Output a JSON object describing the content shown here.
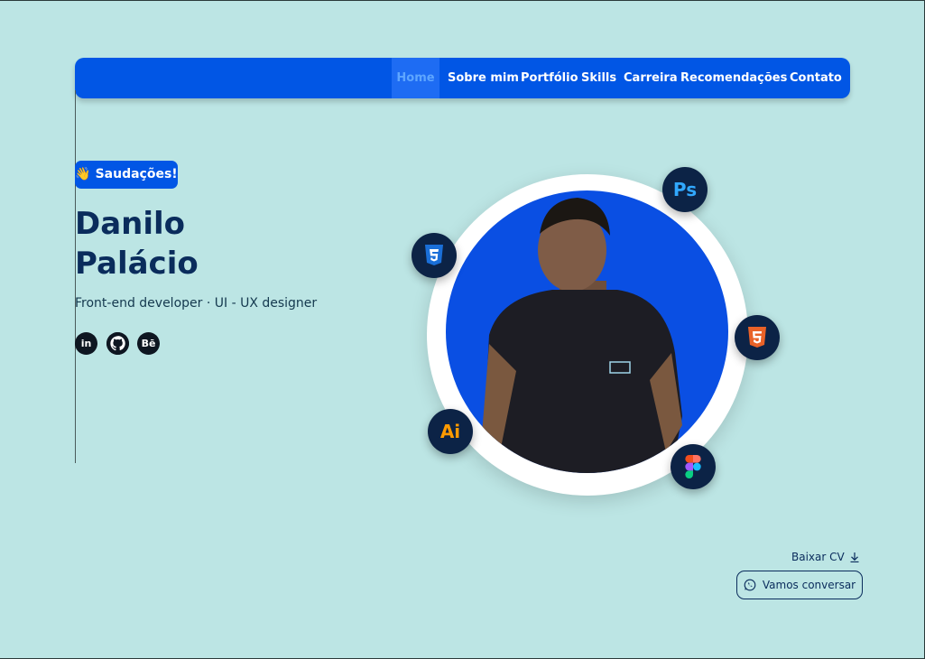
{
  "nav": {
    "items": [
      "Home",
      "Sobre mim",
      "Portfólio",
      "Skills",
      "Carreira",
      "Recomendações",
      "Contato"
    ],
    "active": "Home"
  },
  "hero": {
    "greeting_emoji": "👋",
    "greeting": "Saudações!",
    "name_line1": "Danilo",
    "name_line2": "Palácio",
    "role": "Front-end developer · UI - UX designer"
  },
  "social": {
    "linkedin": "in",
    "github": "github-icon",
    "behance": "Bē"
  },
  "skills": {
    "ps": "Ps",
    "css": "css3-icon",
    "html": "html5-icon",
    "ai": "Ai",
    "figma": "figma-icon"
  },
  "actions": {
    "download_cv": "Baixar CV",
    "chat": "Vamos conversar"
  },
  "colors": {
    "background": "#bce5e4",
    "primary": "#0156e5",
    "navy": "#0a2c5c"
  }
}
